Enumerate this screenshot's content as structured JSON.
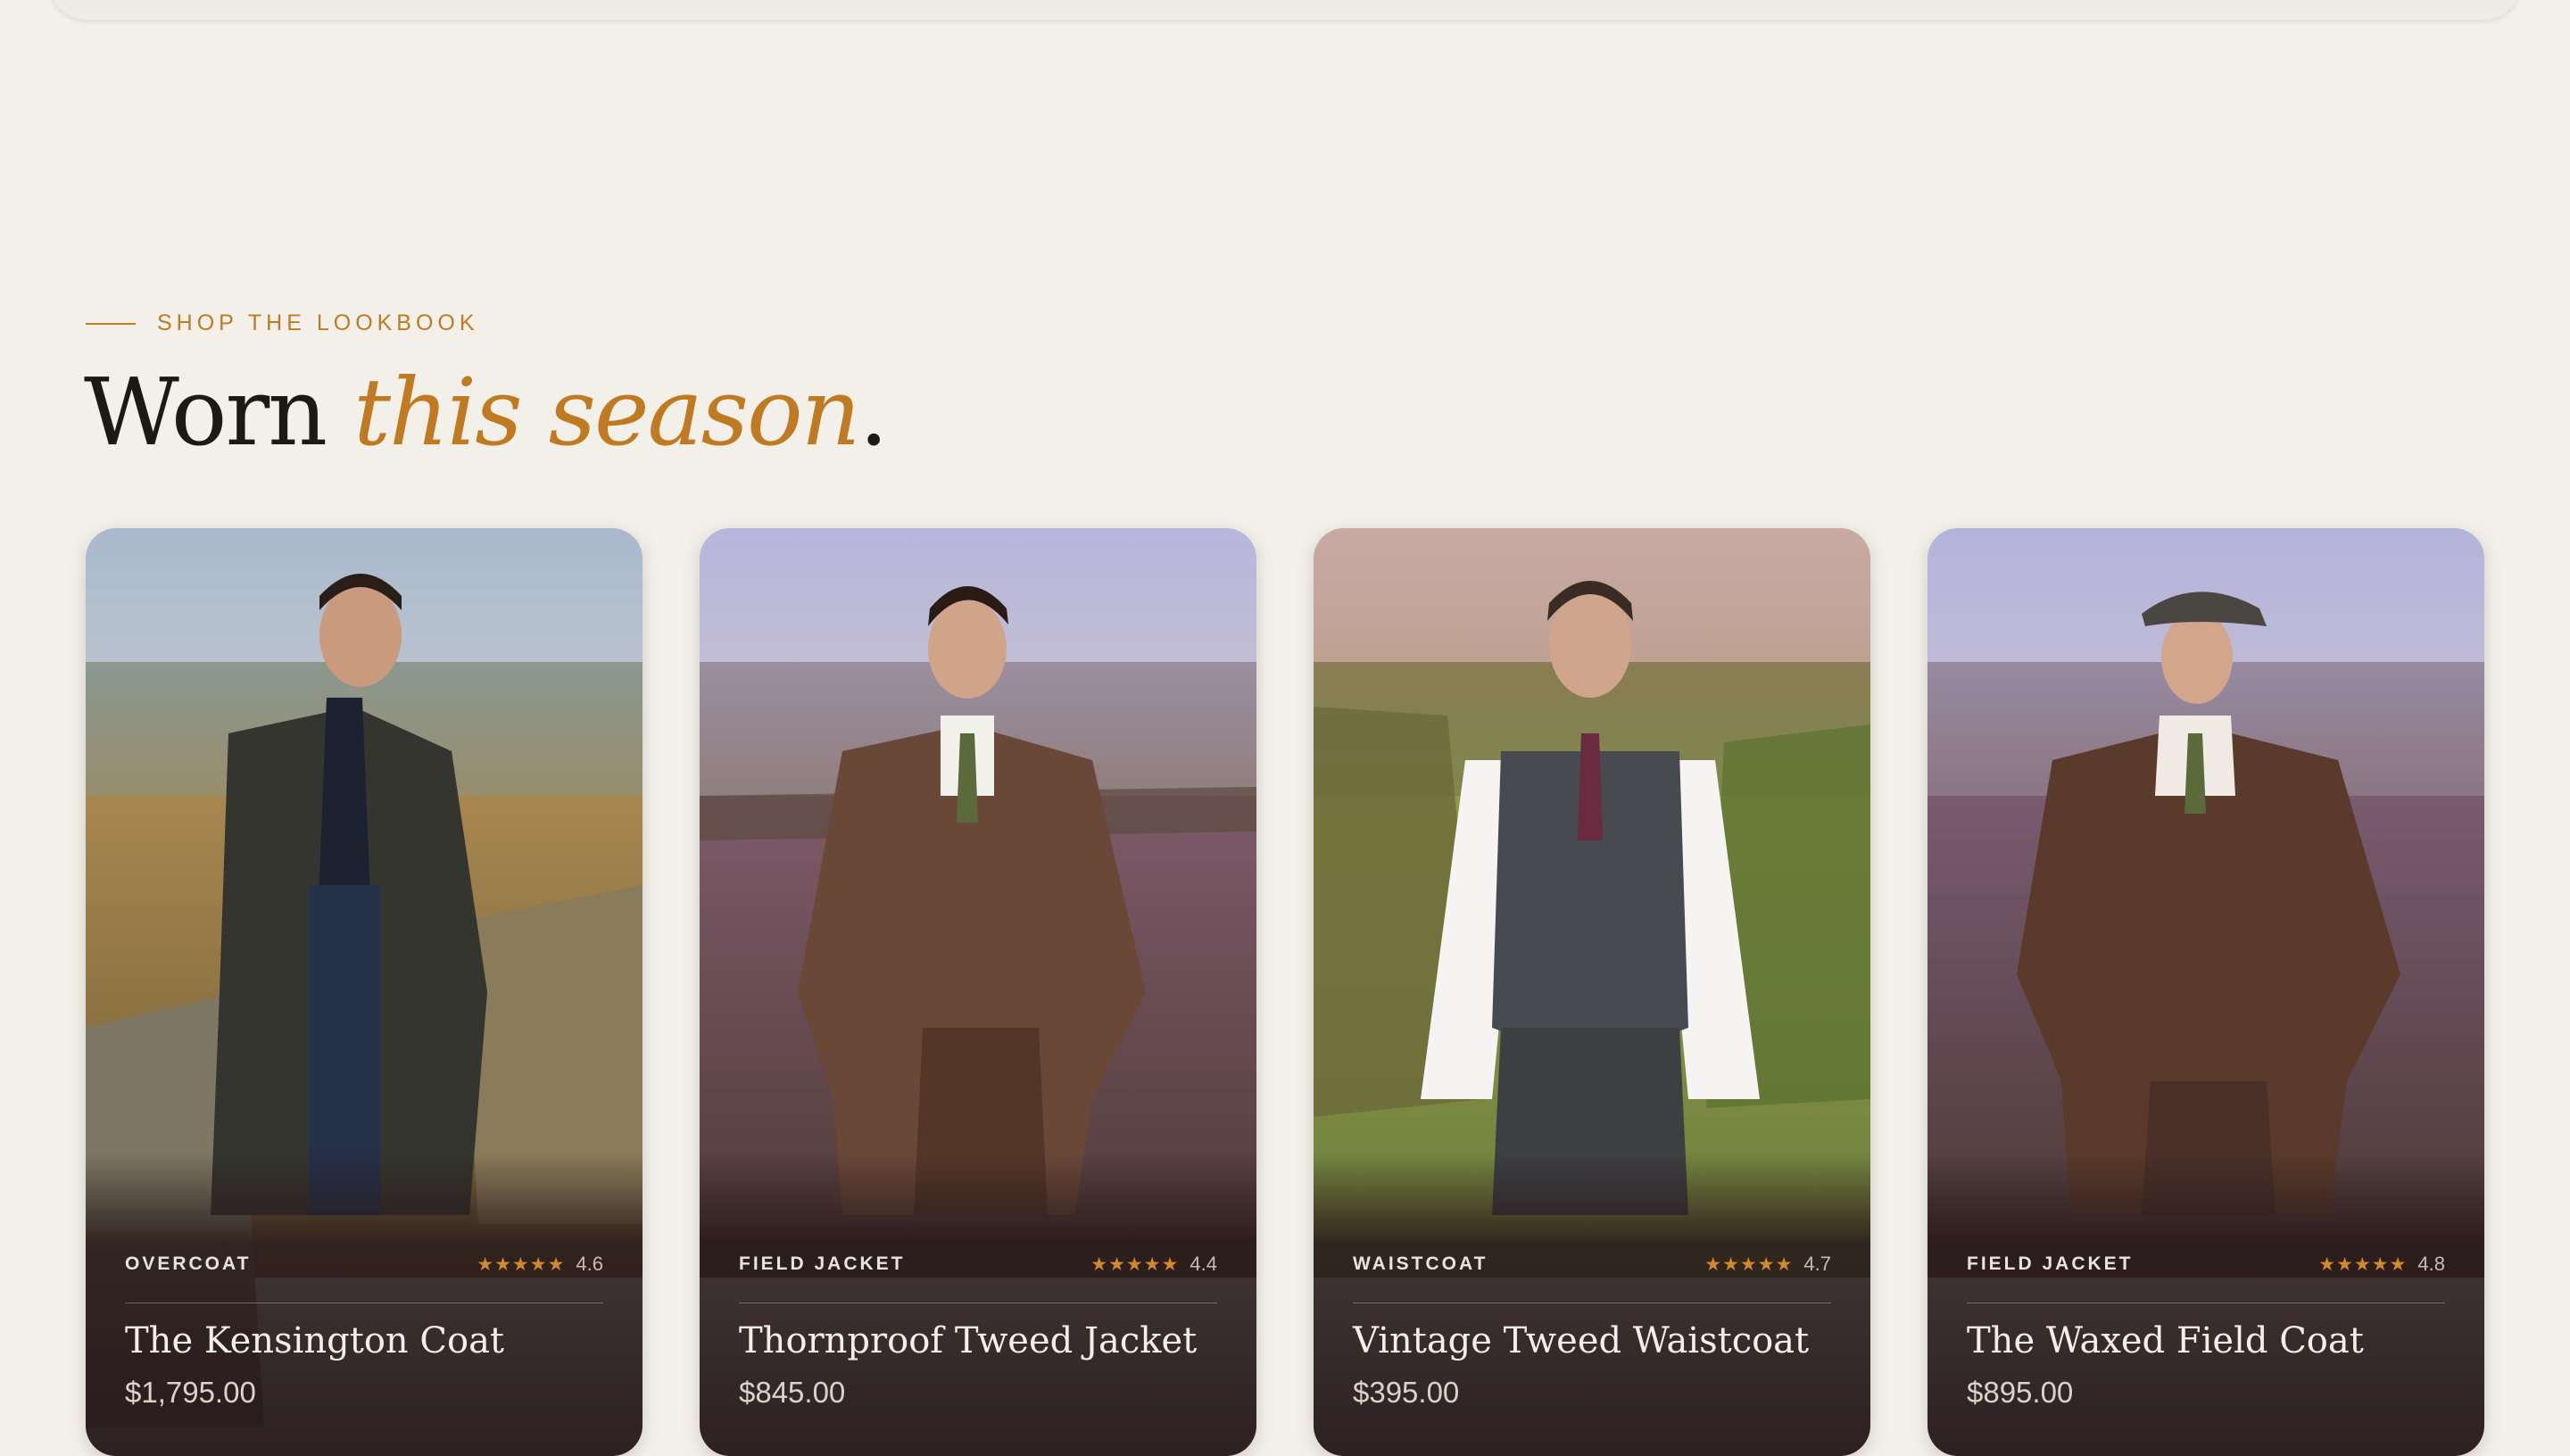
{
  "section": {
    "eyebrow": "SHOP THE LOOKBOOK",
    "heading_lead": "Worn ",
    "heading_accent": "this season",
    "heading_tail": "."
  },
  "colors": {
    "accent": "#c07a22",
    "star": "#d08a2c",
    "background": "#f3f0ea",
    "card_overlay": "#281a1a"
  },
  "products": [
    {
      "category": "OVERCOAT",
      "stars": "★★★★★",
      "rating": "4.6",
      "name": "The Kensington Coat",
      "price": "$1,795.00",
      "image": "model-overcoat-photo"
    },
    {
      "category": "FIELD JACKET",
      "stars": "★★★★★",
      "rating": "4.4",
      "name": "Thornproof Tweed Jacket",
      "price": "$845.00",
      "image": "model-tweed-jacket-photo"
    },
    {
      "category": "WAISTCOAT",
      "stars": "★★★★★",
      "rating": "4.7",
      "name": "Vintage Tweed Waistcoat",
      "price": "$395.00",
      "image": "model-waistcoat-photo"
    },
    {
      "category": "FIELD JACKET",
      "stars": "★★★★★",
      "rating": "4.8",
      "name": "The Waxed Field Coat",
      "price": "$895.00",
      "image": "model-field-coat-photo"
    }
  ]
}
